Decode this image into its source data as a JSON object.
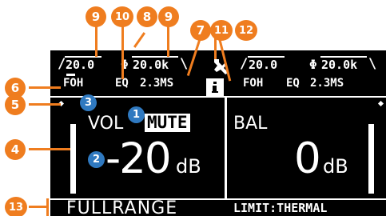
{
  "screen": {
    "ch_a": {
      "hpf_slope": "/",
      "hpf_freq": "20.0",
      "phase_symbol": "Φ",
      "lpf_freq": "20.0k",
      "lpf_slope": "\\",
      "filter_type": "FOH",
      "eq_label": "EQ",
      "delay": "2.3MS"
    },
    "ch_b": {
      "hpf_slope": "/",
      "hpf_freq": "20.0",
      "phase_symbol": "Φ",
      "lpf_freq": "20.0k",
      "lpf_slope": "\\",
      "filter_type": "FOH",
      "eq_label": "EQ",
      "delay": "2.3MS"
    },
    "setup_icon": "wrench-icon",
    "info_icon": "info-icon",
    "volume": {
      "label": "VOL",
      "mute_badge": "MUTE",
      "value": "-20",
      "unit": "dB"
    },
    "balance": {
      "label": "BAL",
      "value": "0",
      "unit": "dB"
    },
    "footer": {
      "mode": "FULLRANGE",
      "limit": "LIMIT:THERMAL"
    }
  },
  "callouts": {
    "c1": "1",
    "c2": "2",
    "c3": "3",
    "c4": "4",
    "c5": "5",
    "c6": "6",
    "c7": "7",
    "c8": "8",
    "c9a": "9",
    "c9b": "9",
    "c10": "10",
    "c11": "11",
    "c12": "12",
    "c13": "13"
  },
  "colors": {
    "orange": "#ef7d1f",
    "blue": "#2f79c0",
    "screen": "#000000",
    "pixel": "#ffffff"
  }
}
